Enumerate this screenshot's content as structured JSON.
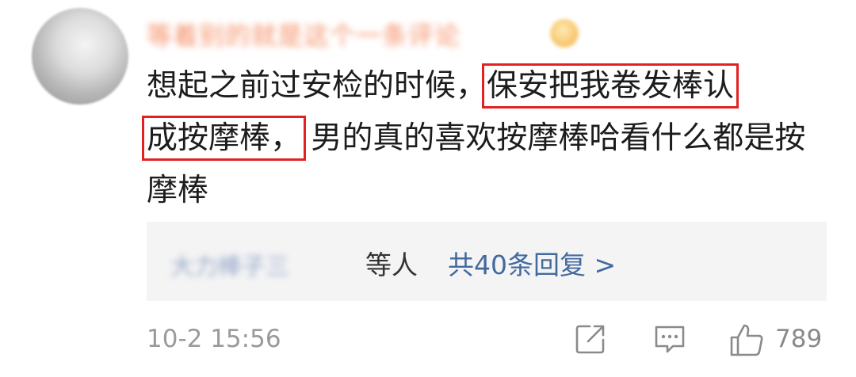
{
  "comment": {
    "username": "等着别的就是这个一条评论",
    "text_before": "想起之前过安检的时候，",
    "highlight_1": "保安把我卷发棒认",
    "highlight_2": "成按摩棒，",
    "text_after": "男的真的喜欢按摩棒哈看什么都是按摩棒",
    "highlight_color": "#e22222"
  },
  "replies": {
    "names": "大力棒子三",
    "suffix": "等人",
    "total": "共40条回复 >"
  },
  "footer": {
    "timestamp": "10-2 15:56",
    "like_count": "789"
  },
  "icons": {
    "share": "share-icon",
    "comment": "comment-icon",
    "like": "thumbs-up-icon"
  }
}
